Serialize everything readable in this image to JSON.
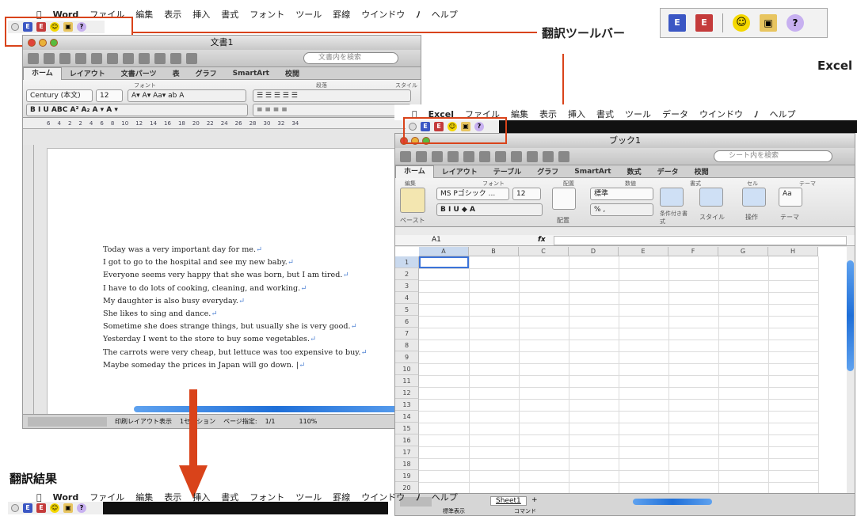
{
  "word_menubar": {
    "apple": "",
    "app": "Word",
    "items": [
      "ファイル",
      "編集",
      "表示",
      "挿入",
      "書式",
      "フォント",
      "ツール",
      "罫線",
      "ウインドウ",
      "",
      "ヘルプ"
    ]
  },
  "excel_menubar": {
    "app": "Excel",
    "items": [
      "ファイル",
      "編集",
      "表示",
      "挿入",
      "書式",
      "ツール",
      "データ",
      "ウインドウ",
      "",
      "ヘルプ"
    ]
  },
  "toolbar_icons": [
    "E",
    "E",
    "☺",
    "▣",
    "?"
  ],
  "callout_label": "翻訳ツールバー",
  "excel_label": "Excel",
  "result_label": "翻訳結果",
  "word_window": {
    "title": "文書1",
    "search_placeholder": "文書内を検索",
    "tabs": [
      "ホーム",
      "レイアウト",
      "文書パーツ",
      "表",
      "グラフ",
      "SmartArt",
      "校閲"
    ],
    "font_name": "Century (本文)",
    "font_size": "12",
    "group_font": "フォント",
    "group_paragraph": "段落",
    "group_style": "スタイル",
    "ruler": [
      "6",
      "4",
      "2",
      "2",
      "4",
      "6",
      "8",
      "10",
      "12",
      "14",
      "16",
      "18",
      "20",
      "22",
      "24",
      "26",
      "28",
      "30",
      "32",
      "34"
    ],
    "lines": [
      "Today was a very important day for me.",
      "I got to go to the hospital and see my new baby.",
      "Everyone seems very happy that she was born, but I am tired.",
      "I have to do lots of cooking, cleaning, and working.",
      "My daughter is also busy everyday.",
      "She likes to sing and dance.",
      "Sometime she does strange things, but usually she is very good.",
      "Yesterday I went to the store to buy some vegetables.",
      "The carrots were very cheap, but lettuce was too expensive to buy.",
      "Maybe someday the prices in Japan will go down."
    ],
    "return_mark": "↵",
    "status": {
      "view": "印刷レイアウト表示",
      "section": "1セクション",
      "page_label": "ページ指定:",
      "page": "1/1",
      "zoom": "110%"
    }
  },
  "excel_window": {
    "title": "ブック1",
    "search_placeholder": "シート内を検索",
    "tabs": [
      "ホーム",
      "レイアウト",
      "テーブル",
      "グラフ",
      "SmartArt",
      "数式",
      "データ",
      "校閲"
    ],
    "groups": [
      "編集",
      "フォント",
      "配置",
      "数値",
      "書式",
      "セル",
      "テーマ"
    ],
    "font_name": "MS Pゴシック ...",
    "font_size": "12",
    "number_format": "標準",
    "paste_label": "ペースト",
    "align_label": "配置",
    "cond_label": "条件付き書式",
    "style_label": "スタイル",
    "ops_label": "操作",
    "theme_label": "テーマ",
    "cell_ref": "A1",
    "fx": "fx",
    "columns": [
      "A",
      "B",
      "C",
      "D",
      "E",
      "F",
      "G",
      "H"
    ],
    "rows": [
      "1",
      "2",
      "3",
      "4",
      "5",
      "6",
      "7",
      "8",
      "9",
      "10",
      "11",
      "12",
      "13",
      "14",
      "15",
      "16",
      "17",
      "18",
      "19",
      "20"
    ],
    "sheet_tab": "Sheet1",
    "status_left": "標準表示",
    "status_mid": "コマンド"
  }
}
